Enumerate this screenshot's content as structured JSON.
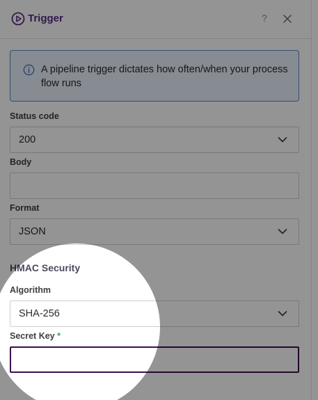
{
  "header": {
    "title": "Trigger",
    "help_label": "?",
    "icons": {
      "trigger": "play-circle-icon",
      "close": "close-icon"
    }
  },
  "info": {
    "icon": "info-circle-icon",
    "text": "A pipeline trigger dictates how often/when your process flow runs"
  },
  "fields": {
    "status_code": {
      "label": "Status code",
      "value": "200"
    },
    "body": {
      "label": "Body",
      "value": ""
    },
    "format": {
      "label": "Format",
      "value": "JSON"
    }
  },
  "hmac": {
    "section_title": "HMAC Security",
    "algorithm": {
      "label": "Algorithm",
      "value": "SHA-256"
    },
    "secret_key": {
      "label": "Secret Key",
      "required_mark": "*",
      "value": ""
    }
  },
  "colors": {
    "brand": "#5b2a86",
    "info_border": "#5a86c9",
    "focus_border": "#3b0f52",
    "required": "#2fa84f",
    "dim_overlay": "rgba(0,0,0,0.45)"
  }
}
